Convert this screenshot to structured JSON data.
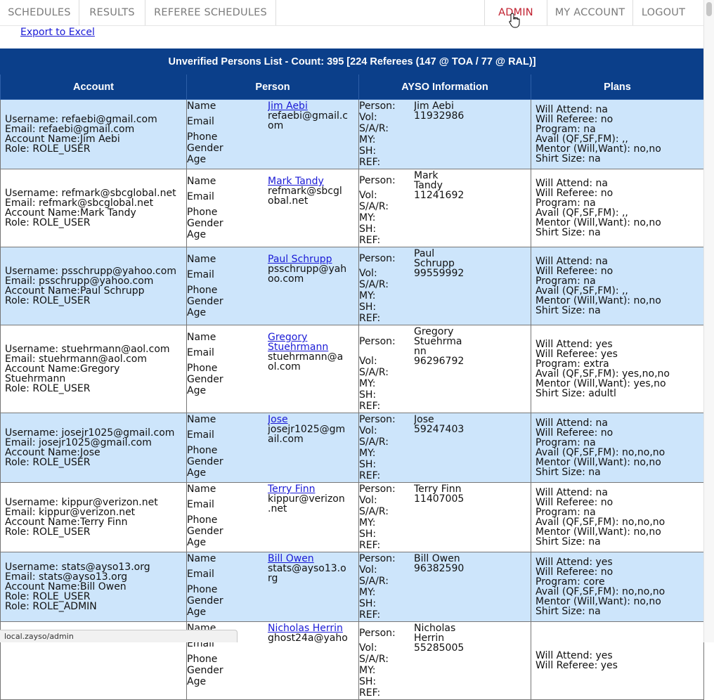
{
  "nav": {
    "schedules": "SCHEDULES",
    "results": "RESULTS",
    "referee_schedules": "REFEREE SCHEDULES",
    "admin": "ADMIN",
    "my_account": "MY ACCOUNT",
    "logout": "LOGOUT"
  },
  "export_label": "Export to Excel",
  "table": {
    "caption": "Unverified Persons List - Count: 395 [224 Referees (147 @ TOA / 77 @ RAL)]",
    "headers": [
      "Account",
      "Person",
      "AYSO Information",
      "Plans"
    ],
    "rows": [
      {
        "account": [
          "Username: refaebi@gmail.com",
          "Email: refaebi@gmail.com",
          "Account Name:Jim Aebi",
          "Role: ROLE_USER"
        ],
        "person_name": "Jim Aebi",
        "person_email": "refaebi@gmail.c\nom",
        "ayso_person": "Jim Aebi",
        "ayso_vol": "11932986",
        "plans": [
          "Will Attend: na",
          "Will Referee: no",
          "Program: na",
          "Avail (QF,SF,FM): ,,",
          "Mentor (Will,Want): no,no",
          "Shirt Size: na"
        ]
      },
      {
        "account": [
          "Username: refmark@sbcglobal.net",
          "Email: refmark@sbcglobal.net",
          "Account Name:Mark Tandy",
          "Role: ROLE_USER"
        ],
        "person_name": "Mark Tandy",
        "person_email": "refmark@sbcgl\nobal.net",
        "ayso_person": "Mark\nTandy",
        "ayso_vol": "11241692",
        "plans": [
          "Will Attend: na",
          "Will Referee: no",
          "Program: na",
          "Avail (QF,SF,FM): ,,",
          "Mentor (Will,Want): no,no",
          "Shirt Size: na"
        ]
      },
      {
        "account": [
          "Username: psschrupp@yahoo.com",
          "Email: psschrupp@yahoo.com",
          "Account Name:Paul Schrupp",
          "Role: ROLE_USER"
        ],
        "person_name": "Paul Schrupp",
        "person_email": "psschrupp@yah\noo.com",
        "ayso_person": "Paul\nSchrupp",
        "ayso_vol": "99559992",
        "plans": [
          "Will Attend: na",
          "Will Referee: no",
          "Program: na",
          "Avail (QF,SF,FM): ,,",
          "Mentor (Will,Want): no,no",
          "Shirt Size: na"
        ]
      },
      {
        "account": [
          "Username: stuehrmann@aol.com",
          "Email: stuehrmann@aol.com",
          "Account Name:Gregory",
          "Stuehrmann",
          "Role: ROLE_USER"
        ],
        "person_name": "Gregory\nStuehrmann",
        "person_email": "stuehrmann@a\nol.com",
        "ayso_person": "Gregory\nStuehrma\nnn",
        "ayso_vol": "96296792",
        "plans": [
          "Will Attend: yes",
          "Will Referee: yes",
          "Program: extra",
          "Avail (QF,SF,FM): yes,no,no",
          "Mentor (Will,Want): yes,no",
          "Shirt Size: adultl"
        ]
      },
      {
        "account": [
          "Username: josejr1025@gmail.com",
          "Email: josejr1025@gmail.com",
          "Account Name:Jose",
          "Role: ROLE_USER"
        ],
        "person_name": "Jose",
        "person_email": "josejr1025@gm\nail.com",
        "ayso_person": "Jose",
        "ayso_vol": "59247403",
        "plans": [
          "Will Attend: na",
          "Will Referee: no",
          "Program: na",
          "Avail (QF,SF,FM): no,no,no",
          "Mentor (Will,Want): no,no",
          "Shirt Size: na"
        ]
      },
      {
        "account": [
          "Username: kippur@verizon.net",
          "Email: kippur@verizon.net",
          "Account Name:Terry Finn",
          "Role: ROLE_USER"
        ],
        "person_name": "Terry Finn",
        "person_email": "kippur@verizon\n.net",
        "ayso_person": "Terry Finn",
        "ayso_vol": "11407005",
        "plans": [
          "Will Attend: na",
          "Will Referee: no",
          "Program: na",
          "Avail (QF,SF,FM): no,no,no",
          "Mentor (Will,Want): no,no",
          "Shirt Size: na"
        ]
      },
      {
        "account": [
          "Username: stats@ayso13.org",
          "Email: stats@ayso13.org",
          "Account Name:Bill Owen",
          "Role: ROLE_USER",
          "Role: ROLE_ADMIN"
        ],
        "person_name": "Bill Owen",
        "person_email": "stats@ayso13.o\nrg",
        "ayso_person": "Bill Owen",
        "ayso_vol": "96382590",
        "plans": [
          "Will Attend: yes",
          "Will Referee: no",
          "Program: core",
          "Avail (QF,SF,FM): no,no,no",
          "Mentor (Will,Want): no,no",
          "Shirt Size: na"
        ]
      },
      {
        "account": [],
        "person_name": "Nicholas Herrin",
        "person_email": "ghost24a@yaho",
        "ayso_person": "Nicholas\nHerrin",
        "ayso_vol": "55285005",
        "plans": [
          "Will Attend: yes",
          "Will Referee: yes"
        ]
      }
    ],
    "person_labels": [
      "Name",
      "Email",
      "Phone",
      "Gender",
      "Age"
    ],
    "ayso_labels": [
      "Person:",
      "Vol:",
      "S/A/R:",
      "MY:",
      "SH:",
      "REF:"
    ]
  },
  "status_url": "local.zayso/admin"
}
